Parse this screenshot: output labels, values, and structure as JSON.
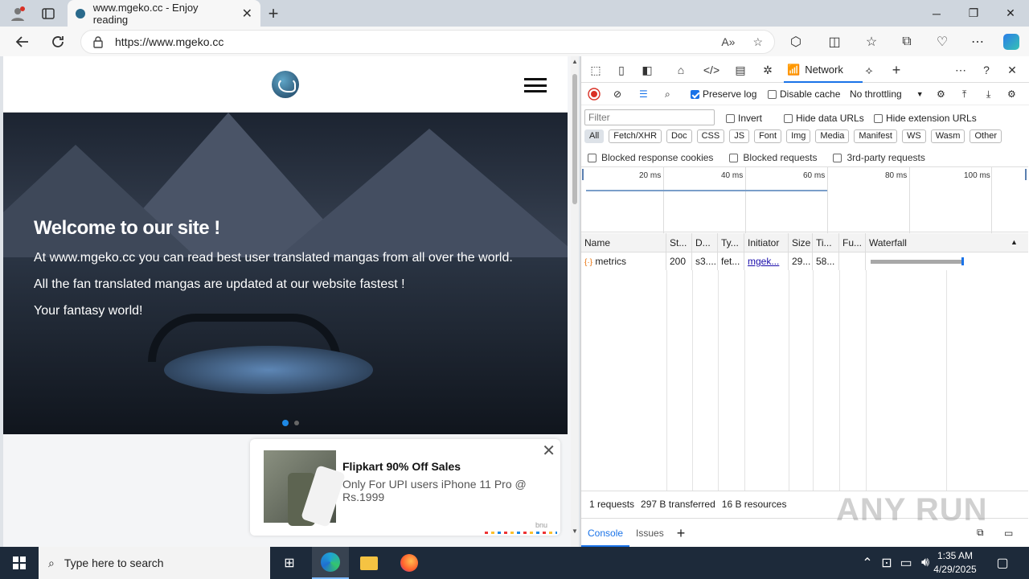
{
  "browser": {
    "tab_title": "www.mgeko.cc - Enjoy reading",
    "url": "https://www.mgeko.cc",
    "window_controls": {
      "minimize": "─",
      "maximize": "❐",
      "close": "✕"
    }
  },
  "site": {
    "hero_title": "Welcome to our site !",
    "hero_lines": [
      "At www.mgeko.cc you can read best user translated mangas from all over the world.",
      "All the fan translated mangas are updated at our website fastest !",
      "Your fantasy world!"
    ],
    "ad": {
      "title": "Flipkart 90% Off Sales",
      "description": "Only For UPI users iPhone 11 Pro @ Rs.1999",
      "brand": "bnu"
    }
  },
  "devtools": {
    "active_tab": "Network",
    "toolbar": {
      "preserve_log": "Preserve log",
      "disable_cache": "Disable cache",
      "throttling": "No throttling"
    },
    "filter_placeholder": "Filter",
    "invert": "Invert",
    "hide_data_urls": "Hide data URLs",
    "hide_extension_urls": "Hide extension URLs",
    "type_filters": [
      "All",
      "Fetch/XHR",
      "Doc",
      "CSS",
      "JS",
      "Font",
      "Img",
      "Media",
      "Manifest",
      "WS",
      "Wasm",
      "Other"
    ],
    "blocked": {
      "response_cookies": "Blocked response cookies",
      "requests": "Blocked requests",
      "third_party": "3rd-party requests"
    },
    "timeline_ticks": [
      "20 ms",
      "40 ms",
      "60 ms",
      "80 ms",
      "100 ms"
    ],
    "columns": [
      "Name",
      "St...",
      "D...",
      "Ty...",
      "Initiator",
      "Size",
      "Ti...",
      "Fu...",
      "Waterfall"
    ],
    "rows": [
      {
        "name": "metrics",
        "status": "200",
        "domain": "s3....",
        "type": "fet...",
        "initiator": "mgek...",
        "size": "29...",
        "time": "58..."
      }
    ],
    "status_bar": {
      "requests": "1 requests",
      "transferred": "297 B transferred",
      "resources": "16 B resources"
    },
    "drawer_tabs": [
      "Console",
      "Issues"
    ]
  },
  "watermark": "ANY RUN",
  "taskbar": {
    "search_placeholder": "Type here to search",
    "time": "1:35 AM",
    "date": "4/29/2025"
  }
}
